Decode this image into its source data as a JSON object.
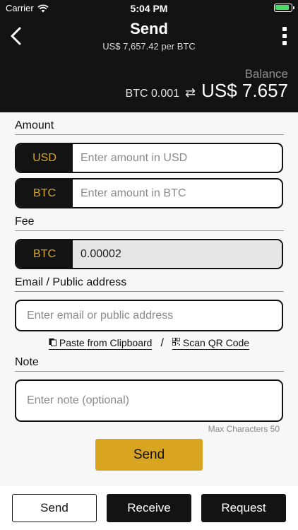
{
  "status": {
    "carrier": "Carrier",
    "time": "5:04 PM"
  },
  "header": {
    "title": "Send",
    "subtitle": "US$ 7,657.42 per BTC"
  },
  "balance": {
    "label": "Balance",
    "btc": "BTC 0.001",
    "swap_symbol": "⇄",
    "usd": "US$ 7.657"
  },
  "amount": {
    "label": "Amount",
    "usd": {
      "currency": "USD",
      "placeholder": "Enter amount in USD"
    },
    "btc": {
      "currency": "BTC",
      "placeholder": "Enter amount in BTC"
    }
  },
  "fee": {
    "label": "Fee",
    "currency": "BTC",
    "value": "0.00002"
  },
  "address": {
    "label": "Email / Public address",
    "placeholder": "Enter email or public address",
    "paste_label": "Paste from Clipboard",
    "separator": "/",
    "scan_label": "Scan QR Code"
  },
  "note": {
    "label": "Note",
    "placeholder": "Enter note (optional)",
    "max_chars": "Max Characters 50"
  },
  "send_button": "Send",
  "tabs": [
    {
      "label": "Send"
    },
    {
      "label": "Receive"
    },
    {
      "label": "Request"
    }
  ],
  "colors": {
    "accent": "#d9a521",
    "dark": "#131313"
  },
  "icons": {
    "back": "chevron-left-icon",
    "menu": "kebab-menu-icon",
    "paste": "clipboard-icon",
    "scan": "qr-code-icon",
    "wifi": "wifi-icon",
    "battery": "battery-icon"
  }
}
